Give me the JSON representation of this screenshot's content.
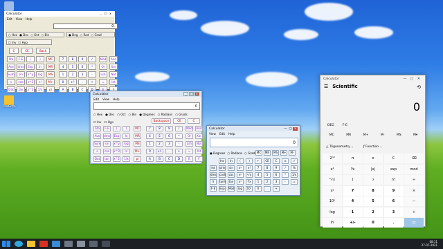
{
  "desktop": {
    "icons": [
      {
        "label": ""
      },
      {
        "label": ""
      },
      {
        "label": ""
      },
      {
        "label": "CalcExtra"
      }
    ]
  },
  "win1": {
    "title": "Calculator",
    "controls": [
      "_",
      "□",
      "x"
    ],
    "menu": [
      "Edit",
      "View",
      "Help"
    ],
    "display": "0.",
    "radix": [
      "Hex",
      "Dec",
      "Oct",
      "Bin"
    ],
    "angle": [
      "Deg",
      "Rad",
      "Grad"
    ],
    "flags": [
      "Inv",
      "Hyp"
    ],
    "top_keys": [
      "C",
      "CE",
      "Back"
    ],
    "rows": [
      [
        "Sta",
        "F-E",
        "(",
        ")",
        "MC",
        "7",
        "8",
        "9",
        "/",
        "Mod",
        "And"
      ],
      [
        "Ave",
        "dms",
        "Exp",
        "ln",
        "MR",
        "4",
        "5",
        "6",
        "*",
        "Or",
        "Xor"
      ],
      [
        "Sum",
        "sin",
        "x^y",
        "log",
        "MS",
        "1",
        "2",
        "3",
        "-",
        "Lsh",
        "Not"
      ],
      [
        "s",
        "cos",
        "x^3",
        "n!",
        "M+",
        "0",
        "+/-",
        ".",
        "+",
        "=",
        "Int"
      ],
      [
        "Dat",
        "tan",
        "x^2",
        "1/x",
        "pi",
        "A",
        "B",
        "C",
        "D",
        "E",
        "F"
      ]
    ]
  },
  "win2": {
    "title": "Calculator",
    "menu": [
      "Edit",
      "View",
      "Help"
    ],
    "display": "0",
    "radix": [
      "Hex",
      "Dec",
      "Oct",
      "Bin"
    ],
    "angle": [
      "Degrees",
      "Radians",
      "Grads"
    ],
    "flags": [
      "Inv",
      "Hyp"
    ],
    "top_keys": [
      "Backspace",
      "CE",
      "C"
    ],
    "rows": [
      [
        "Sta",
        "F-E",
        "(",
        ")",
        "MC",
        "7",
        "8",
        "9",
        "/",
        "Mod",
        "And"
      ],
      [
        "Ave",
        "dms",
        "Exp",
        "ln",
        "MR",
        "4",
        "5",
        "6",
        "*",
        "Or",
        "Xor"
      ],
      [
        "Sum",
        "sin",
        "x^y",
        "log",
        "MS",
        "1",
        "2",
        "3",
        "-",
        "Lsh",
        "Not"
      ],
      [
        "s",
        "cos",
        "x^3",
        "n!",
        "M+",
        "0",
        "+/-",
        ".",
        "+",
        "=",
        "Int"
      ],
      [
        "Dat",
        "tan",
        "x^2",
        "1/x",
        "pi",
        "A",
        "B",
        "C",
        "D",
        "E",
        "F"
      ]
    ]
  },
  "win3": {
    "title": "Calculator",
    "menu": [
      "View",
      "Edit",
      "Help"
    ],
    "display": "0",
    "angle": [
      "Degrees",
      "Radians",
      "Grads"
    ],
    "mem": [
      "MC",
      "MR",
      "MS",
      "M+",
      "M-"
    ],
    "rows": [
      [
        "",
        "Inv",
        "ln",
        "(",
        ")",
        "←",
        "CE",
        "C",
        "±",
        "√"
      ],
      [
        "Int",
        "sinh",
        "sin",
        "x²",
        "n!",
        "7",
        "8",
        "9",
        "/",
        "%"
      ],
      [
        "dms",
        "cosh",
        "cos",
        "xʸ",
        "ʸ√x",
        "4",
        "5",
        "6",
        "*",
        "1/x"
      ],
      [
        "π",
        "tanh",
        "tan",
        "x³",
        "∛x",
        "1",
        "2",
        "3",
        "-",
        "="
      ],
      [
        "F-E",
        "Exp",
        "Mod",
        "log",
        "10ˣ",
        "0",
        ".",
        "+",
        "",
        ""
      ]
    ]
  },
  "win4": {
    "title": "Calculator",
    "controls": [
      "—",
      "□",
      "✕"
    ],
    "mode": "Scientific",
    "display": "0",
    "angle_unit": "DEG",
    "fe": "F-E",
    "memory": [
      "MC",
      "MR",
      "M+",
      "M-",
      "MS",
      "M▾"
    ],
    "trig": "Trigonometry",
    "func": "Function",
    "keys": [
      [
        "2ⁿᵈ",
        "π",
        "e",
        "C",
        "⌫"
      ],
      [
        "x²",
        "⅟x",
        "|x|",
        "exp",
        "mod"
      ],
      [
        "²√x",
        "(",
        ")",
        "n!",
        "÷"
      ],
      [
        "xʸ",
        "7",
        "8",
        "9",
        "×"
      ],
      [
        "10ˣ",
        "4",
        "5",
        "6",
        "−"
      ],
      [
        "log",
        "1",
        "2",
        "3",
        "+"
      ],
      [
        "ln",
        "+/-",
        "0",
        ".",
        "="
      ]
    ]
  },
  "taskbar": {
    "time": "08:11",
    "date": "27-07-2021"
  },
  "colors": {
    "accent": "#0078d7",
    "classic_red": "#c00000",
    "classic_blue": "#0000c0",
    "classic_purple": "#8a2be2"
  }
}
